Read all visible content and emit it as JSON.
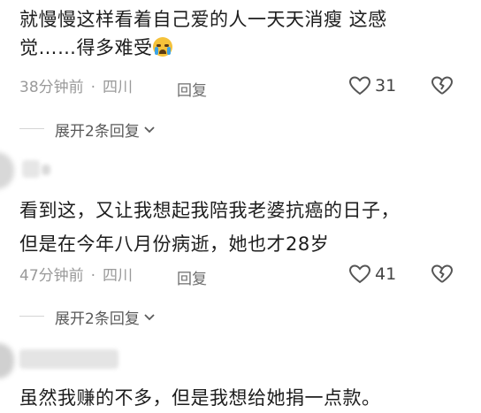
{
  "comments": [
    {
      "text_line1": "就慢慢这样看着自己爱的人一天天消瘦  这感",
      "text_line2": "觉……得多难受",
      "time": "38分钟前",
      "dot": "·",
      "location": "四川",
      "reply_label": "回复",
      "like_count": "31",
      "expand_label": "展开2条回复"
    },
    {
      "text_line1": "看到这，又让我想起我陪我老婆抗癌的日子，",
      "text_line2": "但是在今年八月份病逝，她也才28岁",
      "time": "47分钟前",
      "dot": "·",
      "location": "四川",
      "reply_label": "回复",
      "like_count": "41",
      "expand_label": "展开2条回复"
    },
    {
      "text_line1": "虽然我赚的不多，但是我想给她捐一点款。"
    }
  ],
  "icons": {
    "heart": "heart-icon",
    "dislike": "broken-heart-icon",
    "chevron": "chevron-down-icon",
    "emoji": "crying-face-emoji"
  },
  "colors": {
    "text": "#1d1d1d",
    "meta": "#9a9a9a",
    "divider": "#d5d5d5"
  }
}
